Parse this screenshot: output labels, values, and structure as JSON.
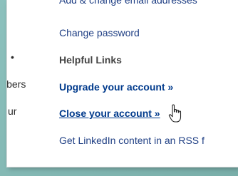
{
  "left_nav": {
    "bullet": "•",
    "item_members_fragment": "ibers",
    "item_your_fragment": "ur"
  },
  "settings": {
    "add_email_label": "Add & change email addresses",
    "change_password_label": "Change password",
    "helpful_links_heading": "Helpful Links",
    "upgrade_account_label": "Upgrade your account »",
    "close_account_label": "Close your account »",
    "rss_label": "Get LinkedIn content in an RSS f"
  },
  "icons": {
    "cursor": "hand-pointer-icon"
  }
}
